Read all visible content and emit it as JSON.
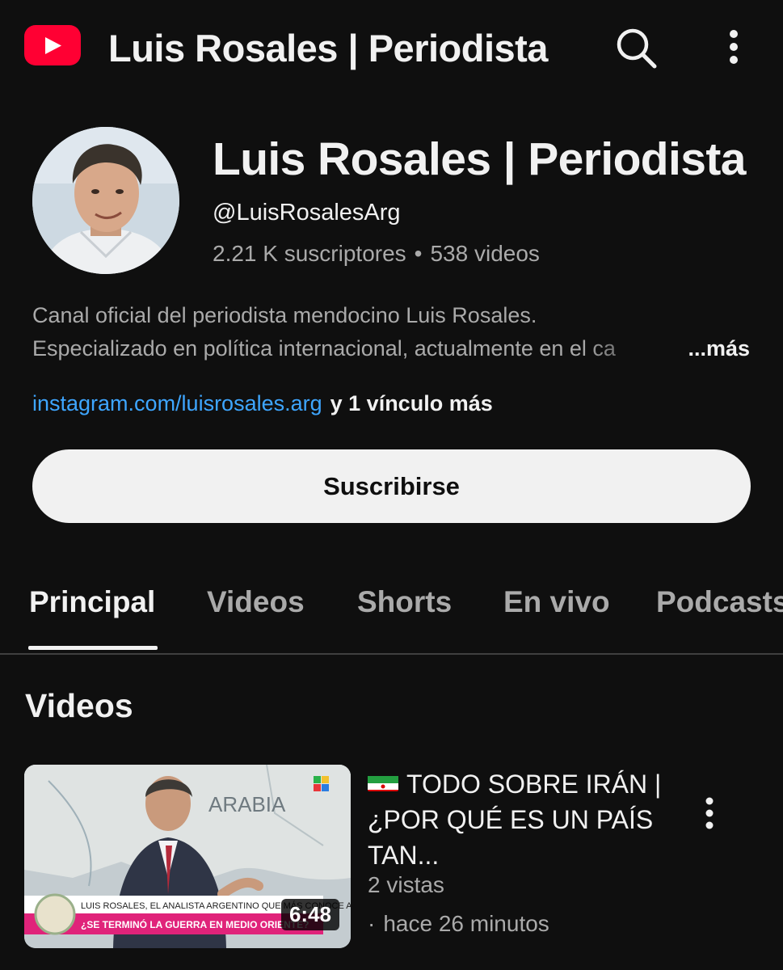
{
  "topbar": {
    "logo_icon": "youtube-logo-icon",
    "title": "Luis Rosales | Periodista",
    "search_icon": "search-icon",
    "more_icon": "more-vertical-icon"
  },
  "channel": {
    "name": "Luis Rosales | Periodista",
    "handle": "@LuisRosalesArg",
    "subscribers": "2.21 K suscriptores",
    "separator": "•",
    "videos_count": "538 videos",
    "description_line1": "Canal oficial del periodista mendocino Luis Rosales.",
    "description_line2": "Especializado en política internacional, actualmente en el ca",
    "description_more": "...más",
    "link": "instagram.com/luisrosales.arg",
    "link_extra": "y 1 vínculo más",
    "subscribe_label": "Suscribirse"
  },
  "tabs": [
    {
      "label": "Principal",
      "active": true
    },
    {
      "label": "Videos",
      "active": false
    },
    {
      "label": "Shorts",
      "active": false
    },
    {
      "label": "En vivo",
      "active": false
    },
    {
      "label": "Podcasts",
      "active": false
    }
  ],
  "section": {
    "title": "Videos"
  },
  "video": {
    "flag_icon": "iran-flag-icon",
    "title": "TODO SOBRE IRÁN | ¿POR QUÉ ES UN PAÍS TAN...",
    "duration": "6:48",
    "views": "2 vistas",
    "separator": "·",
    "time": "hace 26 minutos",
    "menu_icon": "more-vertical-icon",
    "thumb_lower_third": "LUIS ROSALES, EL ANALISTA ARGENTINO QUE MÁS CONOCE A TRUMP",
    "thumb_headline": "¿SE TERMINÓ LA GUERRA EN MEDIO ORIENTE?",
    "thumb_map_label": "ARABIA"
  },
  "colors": {
    "background": "#0f0f0f",
    "text_primary": "#f1f1f1",
    "text_secondary": "#aaaaaa",
    "link": "#3ea6ff",
    "brand_red": "#ff0033"
  }
}
